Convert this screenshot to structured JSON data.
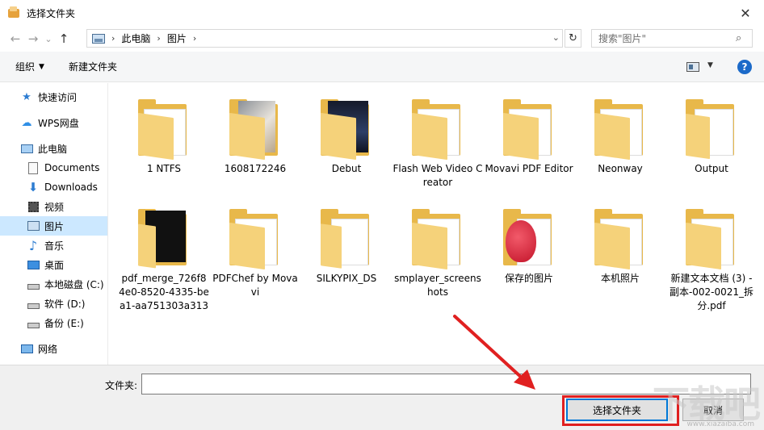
{
  "window": {
    "title": "选择文件夹",
    "close_symbol": "✕"
  },
  "nav": {
    "back_symbol": "←",
    "forward_symbol": "→",
    "recent_symbol": "⌄",
    "up_symbol": "↑",
    "breadcrumb": [
      "此电脑",
      "图片"
    ],
    "refresh_symbol": "↻",
    "search_placeholder": "搜索\"图片\""
  },
  "toolbar": {
    "organize_label": "组织",
    "new_folder_label": "新建文件夹",
    "help_label": "?"
  },
  "sidebar": {
    "items": [
      {
        "label": "快速访问",
        "icon": "star-icon"
      },
      {
        "label": "WPS网盘",
        "icon": "cloud-icon"
      },
      {
        "label": "此电脑",
        "icon": "computer-icon"
      },
      {
        "label": "Documents",
        "icon": "document-icon"
      },
      {
        "label": "Downloads",
        "icon": "download-icon"
      },
      {
        "label": "视频",
        "icon": "video-icon"
      },
      {
        "label": "图片",
        "icon": "picture-icon"
      },
      {
        "label": "音乐",
        "icon": "music-icon"
      },
      {
        "label": "桌面",
        "icon": "desktop-icon"
      },
      {
        "label": "本地磁盘 (C:)",
        "icon": "drive-icon"
      },
      {
        "label": "软件 (D:)",
        "icon": "drive-icon"
      },
      {
        "label": "备份 (E:)",
        "icon": "drive-icon"
      },
      {
        "label": "网络",
        "icon": "network-icon"
      }
    ],
    "selected": "图片"
  },
  "folders": [
    {
      "label": "1 NTFS"
    },
    {
      "label": "1608172246"
    },
    {
      "label": "Debut"
    },
    {
      "label": "Flash Web Video Creator"
    },
    {
      "label": "Movavi PDF Editor"
    },
    {
      "label": "Neonway"
    },
    {
      "label": "Output"
    },
    {
      "label": "pdf_merge_726f84e0-8520-4335-bea1-aa751303a313"
    },
    {
      "label": "PDFChef by Movavi"
    },
    {
      "label": "SILKYPIX_DS"
    },
    {
      "label": "smplayer_screenshots"
    },
    {
      "label": "保存的图片"
    },
    {
      "label": "本机照片"
    },
    {
      "label": "新建文本文档 (3) - 副本-002-0021_拆分.pdf"
    }
  ],
  "bottom": {
    "folder_label": "文件夹:",
    "folder_value": "",
    "select_button": "选择文件夹",
    "cancel_button": "取消"
  },
  "annotation": {
    "arrow_color": "#e02020"
  },
  "watermark": {
    "text": "下载吧",
    "sub": "www.xiazaiba.com"
  }
}
